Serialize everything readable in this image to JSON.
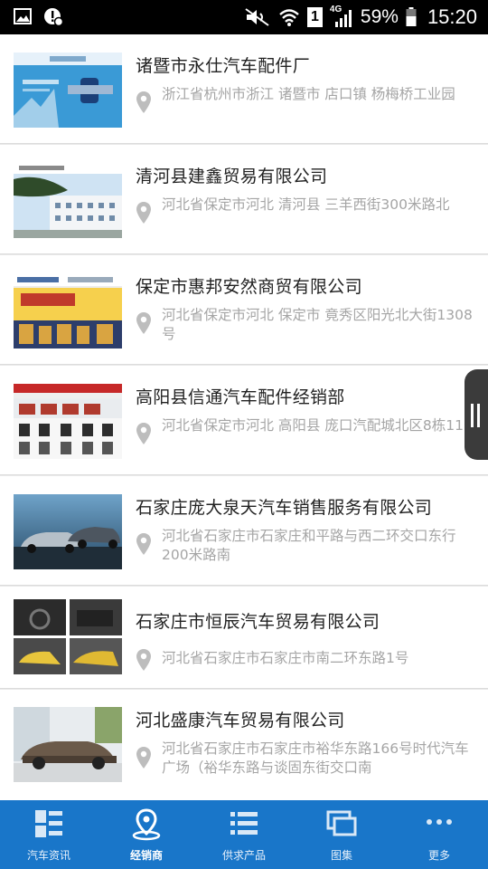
{
  "status_bar": {
    "network_label": "4G",
    "sim_label": "1",
    "battery_percent": "59%",
    "time": "15:20",
    "icons": [
      "gallery-icon",
      "notification-alert-icon",
      "mute-icon",
      "wifi-icon",
      "sim-icon",
      "signal-icon",
      "battery-icon"
    ]
  },
  "dealers": [
    {
      "name": "诸暨市永仕汽车配件厂",
      "address": "浙江省杭州市浙江 诸暨市 店口镇 杨梅桥工业园"
    },
    {
      "name": "清河县建鑫贸易有限公司",
      "address": "河北省保定市河北 清河县 三羊西街300米路北"
    },
    {
      "name": "保定市惠邦安然商贸有限公司",
      "address": "河北省保定市河北 保定市 竟秀区阳光北大街1308号"
    },
    {
      "name": "高阳县信通汽车配件经销部",
      "address": "河北省保定市河北 高阳县 庞口汽配城北区8栋11号"
    },
    {
      "name": "石家庄庞大泉天汽车销售服务有限公司",
      "address": "河北省石家庄市石家庄和平路与西二环交口东行200米路南"
    },
    {
      "name": "石家庄市恒辰汽车贸易有限公司",
      "address": "河北省石家庄市石家庄市南二环东路1号"
    },
    {
      "name": "河北盛康汽车贸易有限公司",
      "address": "河北省石家庄市石家庄市裕华东路166号时代汽车广场（裕华东路与谈固东街交口南"
    }
  ],
  "nav": {
    "items": [
      {
        "label": "汽车资讯",
        "icon": "news-grid-icon"
      },
      {
        "label": "经销商",
        "icon": "location-pin-icon"
      },
      {
        "label": "供求产品",
        "icon": "list-icon"
      },
      {
        "label": "图集",
        "icon": "gallery-icon"
      },
      {
        "label": "更多",
        "icon": "more-icon"
      }
    ],
    "active_index": 1
  },
  "colors": {
    "nav_background": "#1976c9",
    "name_text": "#222222",
    "address_text": "#a5a5a5"
  }
}
